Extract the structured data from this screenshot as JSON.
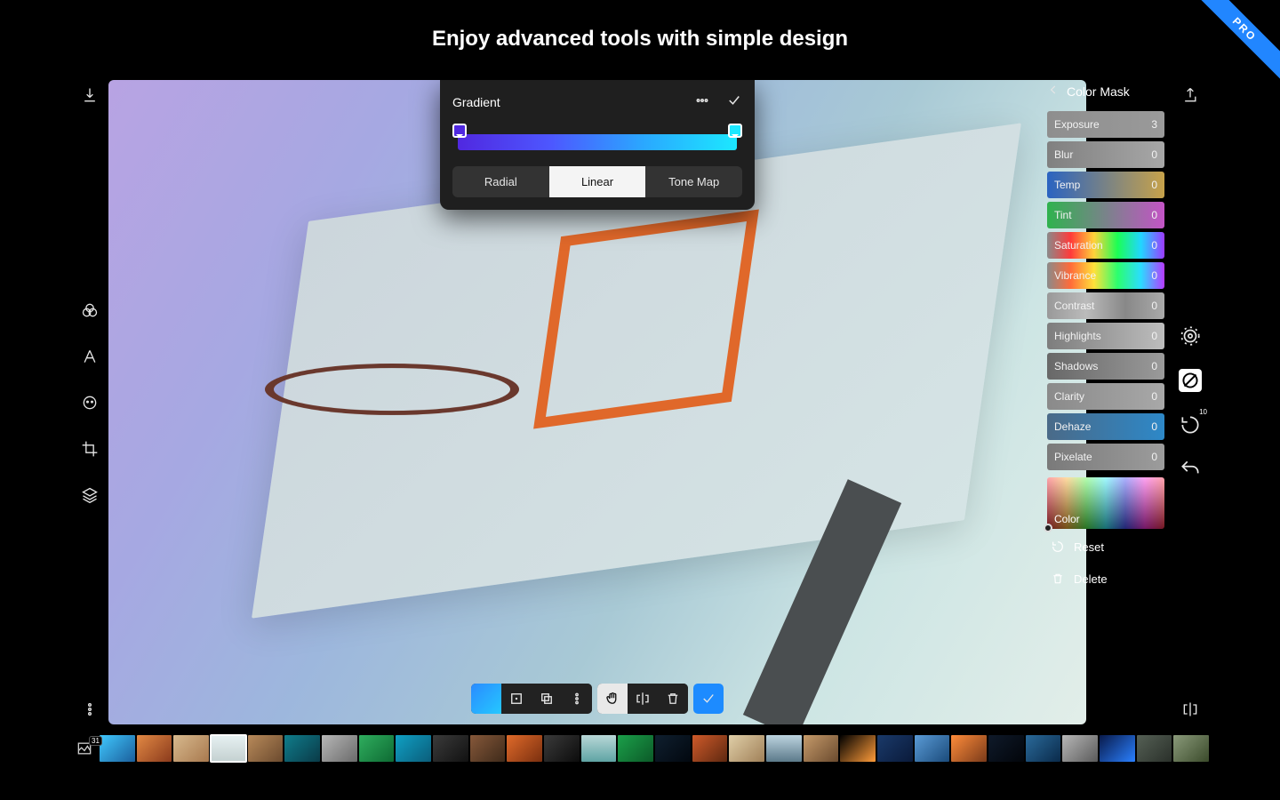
{
  "headline": "Enjoy advanced tools with simple design",
  "ribbon": "PRO",
  "panel": {
    "title": "Color Mask",
    "sliders": [
      {
        "label": "Exposure",
        "value": "3",
        "bg": "linear-gradient(to right,#8e8e8e,#9a9a9a)"
      },
      {
        "label": "Blur",
        "value": "0",
        "bg": "linear-gradient(to right,#808080,#a7a7a7)"
      },
      {
        "label": "Temp",
        "value": "0",
        "bg": "linear-gradient(to right,#2a63c1,#c7a24a)"
      },
      {
        "label": "Tint",
        "value": "0",
        "bg": "linear-gradient(to right,#2fb24e,#c454c6)"
      },
      {
        "label": "Saturation",
        "value": "0",
        "bg": "linear-gradient(to right,#8a8a8a,#ff3a3a,#ffd23a,#1bff55,#21d6ff,#9c3aff)"
      },
      {
        "label": "Vibrance",
        "value": "0",
        "bg": "linear-gradient(to right,#8a8a8a,#ff6b3a,#ffe13a,#2bff6e,#2bdcff,#b63aff)"
      },
      {
        "label": "Contrast",
        "value": "0",
        "bg": "linear-gradient(to right,#999,#bbb,#888,#aaa)"
      },
      {
        "label": "Highlights",
        "value": "0",
        "bg": "linear-gradient(to right,#7d7d7d,#bdbdbd)"
      },
      {
        "label": "Shadows",
        "value": "0",
        "bg": "linear-gradient(to right,#686868,#9a9a9a)"
      },
      {
        "label": "Clarity",
        "value": "0",
        "bg": "linear-gradient(to right,#8a8a8a,#a8a8a8)"
      },
      {
        "label": "Dehaze",
        "value": "0",
        "bg": "linear-gradient(to right,#4a6a88,#2d88c8)"
      },
      {
        "label": "Pixelate",
        "value": "0",
        "bg": "linear-gradient(to right,#7a7a7a,#9c9c9c)"
      }
    ],
    "color_label": "Color",
    "actions": {
      "reset": "Reset",
      "delete": "Delete"
    }
  },
  "gradient_popover": {
    "title": "Gradient",
    "tabs": {
      "radial": "Radial",
      "linear": "Linear",
      "tonemap": "Tone Map"
    },
    "active_tab": "linear",
    "stops": {
      "left": "#5028e0",
      "right": "#1ce8ff"
    }
  },
  "right_rail_badge": "10",
  "filmstrip": {
    "count_badge": "31",
    "selected_index": 3,
    "thumbs": [
      "linear-gradient(135deg,#40c9ff,#1b5e9b)",
      "linear-gradient(135deg,#e28944,#8a3a1c)",
      "linear-gradient(135deg,#d7b98e,#a8794e)",
      "linear-gradient(180deg,#e7f1f2,#c3d0d0)",
      "linear-gradient(135deg,#b88a5a,#6b4a2e)",
      "linear-gradient(135deg,#0f7d8c,#0a3a47)",
      "linear-gradient(135deg,#b7b7b7,#6a6a6a)",
      "linear-gradient(135deg,#2fae5e,#0e6a33)",
      "linear-gradient(135deg,#0fa0c4,#0b5d7a)",
      "linear-gradient(135deg,#3b3b3b,#111)",
      "linear-gradient(135deg,#86583a,#3e2a1a)",
      "linear-gradient(135deg,#e06a2a,#7a2f0f)",
      "linear-gradient(135deg,#3a3a3a,#0c0c0c)",
      "linear-gradient(180deg,#b8d7d7,#5fa4a4)",
      "linear-gradient(135deg,#1ba04a,#0c5a28)",
      "linear-gradient(135deg,#0f1f2f,#02080f)",
      "linear-gradient(135deg,#cf5a2a,#5e2810)",
      "linear-gradient(135deg,#e0cfa8,#a08058)",
      "linear-gradient(180deg,#bcd3df,#5c7a8a)",
      "linear-gradient(135deg,#c59a6a,#6a4a2e)",
      "linear-gradient(135deg,#000,#ff9c3a)",
      "linear-gradient(135deg,#1a3a6a,#0a1a3a)",
      "linear-gradient(135deg,#5a9bd6,#1a4a7a)",
      "linear-gradient(135deg,#ff8c3a,#7a3a1a)",
      "linear-gradient(135deg,#0f1a2a,#02050a)",
      "linear-gradient(135deg,#2a6a9a,#0a2a4a)",
      "linear-gradient(135deg,#b7b7b7,#5a5a5a)",
      "linear-gradient(135deg,#091a4a,#2a80ff)",
      "linear-gradient(135deg,#556055,#2a302a)",
      "linear-gradient(135deg,#8a9a7a,#3a4a2a)"
    ]
  }
}
